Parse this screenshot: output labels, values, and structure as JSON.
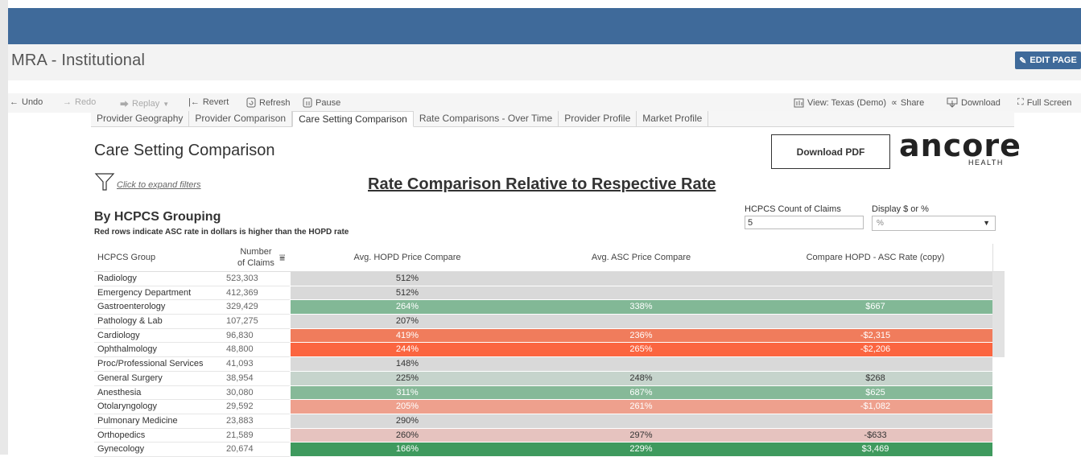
{
  "header": {
    "title": "MRA - Institutional",
    "edit_label": "EDIT PAGE"
  },
  "toolbar": {
    "undo": "Undo",
    "redo": "Redo",
    "replay": "Replay",
    "revert": "Revert",
    "refresh": "Refresh",
    "pause": "Pause",
    "view": "View: Texas (Demo)",
    "share": "Share",
    "download": "Download",
    "fullscreen": "Full Screen"
  },
  "tabs": [
    {
      "label": "Provider Geography"
    },
    {
      "label": "Provider Comparison"
    },
    {
      "label": "Care Setting Comparison",
      "active": true
    },
    {
      "label": "Rate Comparisons - Over Time"
    },
    {
      "label": "Provider Profile"
    },
    {
      "label": "Market Profile"
    }
  ],
  "dashboard": {
    "title": "Care Setting Comparison",
    "filter_link": "Click to expand filters",
    "rate_title": "Rate Comparison Relative to Respective Rate",
    "pdf_button": "Download PDF",
    "logo": {
      "main": "ancore",
      "sub": "HEALTH"
    }
  },
  "params": {
    "count_label": "HCPCS Count of Claims",
    "count_value": "5",
    "display_label": "Display $ or %",
    "display_value": "%"
  },
  "section": {
    "title": "By HCPCS Grouping",
    "subtitle": "Red rows indicate ASC rate in dollars is higher than the HOPD rate"
  },
  "table": {
    "columns": {
      "group": "HCPCS Group",
      "claims_1": "Number",
      "claims_2": "of Claims",
      "hopd": "Avg. HOPD Price Compare",
      "asc": "Avg. ASC Price Compare",
      "compare": "Compare HOPD - ASC Rate  (copy)"
    },
    "rows": [
      {
        "group": "Radiology",
        "claims": "523,303",
        "hopd": "512%",
        "asc": "",
        "compare": "",
        "color": "#d9d9d9",
        "dark": true
      },
      {
        "group": "Emergency Department",
        "claims": "412,369",
        "hopd": "512%",
        "asc": "",
        "compare": "",
        "color": "#d9d9d9",
        "dark": true
      },
      {
        "group": "Gastroenterology",
        "claims": "329,429",
        "hopd": "264%",
        "asc": "338%",
        "compare": "$667",
        "color": "#82b896",
        "dark": false
      },
      {
        "group": "Pathology & Lab",
        "claims": "107,275",
        "hopd": "207%",
        "asc": "",
        "compare": "",
        "color": "#d9d9d9",
        "dark": true
      },
      {
        "group": "Cardiology",
        "claims": "96,830",
        "hopd": "419%",
        "asc": "236%",
        "compare": "-$2,315",
        "color": "#f07c5c",
        "dark": false
      },
      {
        "group": "Ophthalmology",
        "claims": "48,800",
        "hopd": "244%",
        "asc": "265%",
        "compare": "-$2,206",
        "color": "#fb6540",
        "dark": false
      },
      {
        "group": "Proc/Professional Services",
        "claims": "41,093",
        "hopd": "148%",
        "asc": "",
        "compare": "",
        "color": "#d9d9d9",
        "dark": true
      },
      {
        "group": "General Surgery",
        "claims": "38,954",
        "hopd": "225%",
        "asc": "248%",
        "compare": "$268",
        "color": "#c6d4cc",
        "dark": true
      },
      {
        "group": "Anesthesia",
        "claims": "30,080",
        "hopd": "311%",
        "asc": "687%",
        "compare": "$625",
        "color": "#86b998",
        "dark": false
      },
      {
        "group": "Otolaryngology",
        "claims": "29,592",
        "hopd": "205%",
        "asc": "261%",
        "compare": "-$1,082",
        "color": "#eea08d",
        "dark": false
      },
      {
        "group": "Pulmonary Medicine",
        "claims": "23,883",
        "hopd": "290%",
        "asc": "",
        "compare": "",
        "color": "#d9d9d9",
        "dark": true
      },
      {
        "group": "Orthopedics",
        "claims": "21,589",
        "hopd": "260%",
        "asc": "297%",
        "compare": "-$633",
        "color": "#e6c3bf",
        "dark": true
      },
      {
        "group": "Gynecology",
        "claims": "20,674",
        "hopd": "166%",
        "asc": "229%",
        "compare": "$3,469",
        "color": "#3f9a5e",
        "dark": false
      }
    ]
  }
}
